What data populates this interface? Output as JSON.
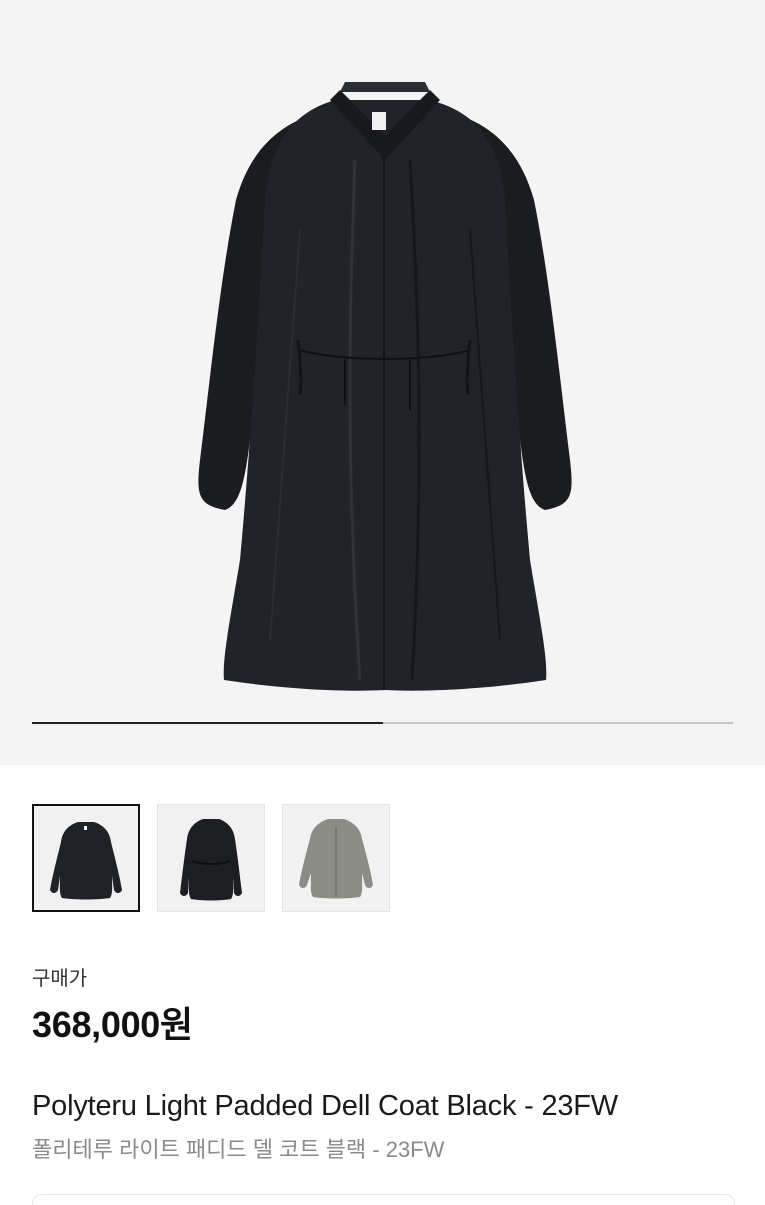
{
  "gallery": {
    "progress": 0.5,
    "main_image": "black-padded-coat-photo",
    "thumbnails": [
      {
        "name": "thumbnail-black-coat-front",
        "color": "#1f2226",
        "selected": true
      },
      {
        "name": "thumbnail-black-coat-belted",
        "color": "#1c1e22",
        "selected": false
      },
      {
        "name": "thumbnail-grey-coat",
        "color": "#8b8d84",
        "selected": false
      }
    ]
  },
  "product": {
    "price_label": "구매가",
    "price": "368,000원",
    "title_en": "Polyteru Light Padded Dell Coat Black - 23FW",
    "title_ko": "폴리테루 라이트 패디드 델 코트 블랙 - 23FW"
  }
}
